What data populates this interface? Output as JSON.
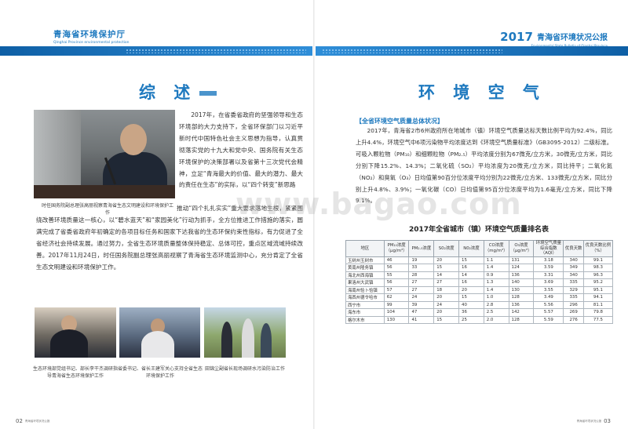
{
  "header": {
    "left_cn": "青海省环境保护厅",
    "left_en": "Qinghai Province environmental protection",
    "right_year": "2017",
    "right_title": "青海省环境状况公报",
    "right_en": "Environmental State Bulletin of Qinghai Province"
  },
  "left_page": {
    "title": "综 述",
    "main_photo_caption": "时任国务院副总理张高丽视察青海省生态文明建设和环境保护工作",
    "p1": "2017年，在省委省政府的坚强领导和生态环境部的大力支持下，全省环保部门以习近平新时代中国特色社会主义思想为指导，认真贯彻落实党的十九大和党中央、国务院有关生态环境保护的决策部署以及省第十三次党代会精神，立足“青海最大的价值、最大的潜力、最大的责任在生态”的实际，以“四个转变”新思路",
    "p2": "推动“四个扎扎实实”重大要求落地生根，紧紧围绕改善环境质量这一核心，以“碧水蓝天”和“家园美化”行动为抓手，全方位推进工作措施的落实，圆满完成了省委省政府年初确定的各项目标任务和国家下达我省的生态环保约束性指标，有力促进了全省经济社会持续发展。通过努力，全省生态环境质量整体保持稳定、总体可控，重点区域流域持续改善。2017年11月24日，时任国务院副总理张高丽视察了青海省生态环境监测中心，充分肯定了全省生态文明建设和环境保护工作。",
    "captions": [
      "生态环境部党组书记、部长李干杰调研指导青海省生态环境保护工作",
      "省委书记、省长王建军关心支持全省生态环境保护工作",
      "田锦尘副省长现场调研水污染防治工作"
    ],
    "page_num": "02",
    "page_sub": "青海省环境状况公报"
  },
  "right_page": {
    "title": "环 境 空 气",
    "subhead": "【全省环境空气质量总体状况】",
    "para": "2017年，青海省2市6州政府所在地城市（镇）环境空气质量达标天数比例平均为92.4%，同比上升4.4%，环境空气中6项污染物平均浓度达到《环境空气质量标准》（GB3095-2012）二级标准。可吸入颗粒物（PM₁₀）和细颗粒物（PM₂.₅）平均浓度分别为67微克/立方米，30微克/立方米，同比分别下降15.2%、14.3%；二氧化硫（SO₂）平均浓度为20微克/立方米，同比持平；二氧化氮（NO₂）和臭氧（O₃）日均值第90百分位浓度平均分别为22微克/立方米、133微克/立方米，同比分别上升4.8%、3.9%；一氧化碳（CO）日均值第95百分位浓度平均为1.6毫克/立方米，同比下降9.1%。",
    "table_title": "2017年全省城市（镇）环境空气质量排名表",
    "table_headers": [
      "地区",
      "PM₁₀浓度",
      "PM₂.₅浓度",
      "S0₂浓度",
      "N0₂浓度",
      "CO浓度",
      "O₃浓度",
      "环境空气质量综合指数（AQI）",
      "优良天数",
      "优良天数比例（%）"
    ],
    "unit_ug": "（μg/m³）",
    "unit_mg": "（mg/m³）",
    "unit_o3": "（μg/m³）",
    "rows": [
      [
        "玉树州玉树市",
        "46",
        "19",
        "20",
        "15",
        "1.1",
        "131",
        "3.18",
        "340",
        "99.1"
      ],
      [
        "黄南州隆务镇",
        "56",
        "33",
        "15",
        "16",
        "1.4",
        "124",
        "3.59",
        "349",
        "98.3"
      ],
      [
        "海北州西海镇",
        "55",
        "28",
        "14",
        "14",
        "0.9",
        "136",
        "3.31",
        "340",
        "96.3"
      ],
      [
        "果洛州大武镇",
        "56",
        "27",
        "27",
        "16",
        "1.3",
        "140",
        "3.69",
        "335",
        "95.2"
      ],
      [
        "海南州恰卜恰镇",
        "57",
        "27",
        "18",
        "20",
        "1.4",
        "130",
        "3.55",
        "329",
        "95.1"
      ],
      [
        "海西州德令哈市",
        "62",
        "24",
        "20",
        "15",
        "1.0",
        "128",
        "3.49",
        "335",
        "94.1"
      ],
      [
        "西宁市",
        "99",
        "39",
        "24",
        "40",
        "2.8",
        "136",
        "5.56",
        "296",
        "81.1"
      ],
      [
        "海东市",
        "104",
        "47",
        "20",
        "36",
        "2.5",
        "142",
        "5.57",
        "269",
        "79.8"
      ],
      [
        "格尔木市",
        "130",
        "41",
        "15",
        "25",
        "2.0",
        "128",
        "5.59",
        "276",
        "77.5"
      ]
    ],
    "page_num": "03",
    "page_sub": "青海省环境状况公报"
  },
  "watermark": "www.bagao.com",
  "colors": {
    "accent": "#1e79bf"
  }
}
